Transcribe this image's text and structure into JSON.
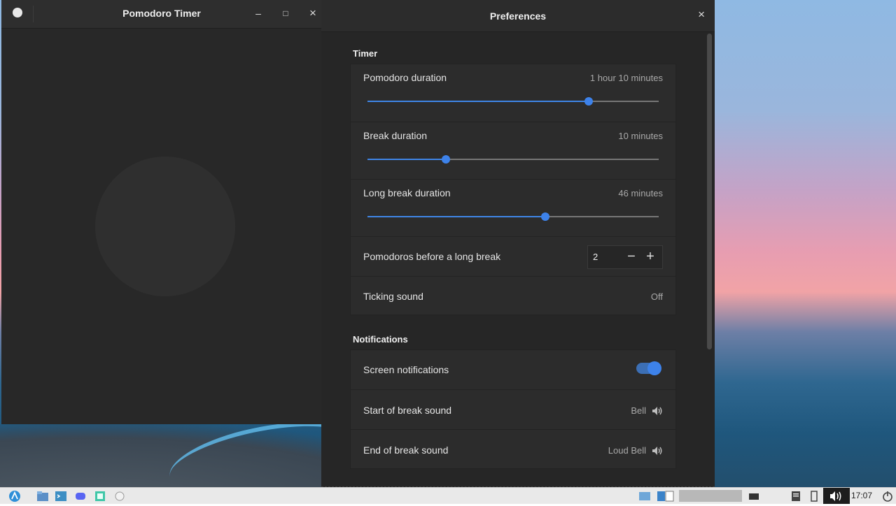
{
  "pomodoro_window": {
    "title": "Pomodoro Timer",
    "minimize_glyph": "–",
    "maximize_glyph": "□",
    "close_glyph": "×",
    "play_icon": "play-icon"
  },
  "preferences": {
    "title": "Preferences",
    "close_glyph": "×",
    "timer_section": "Timer",
    "pomodoro_duration": {
      "label": "Pomodoro duration",
      "value": "1 hour 10 minutes",
      "level": 0.76
    },
    "break_duration": {
      "label": "Break duration",
      "value": "10 minutes",
      "level": 0.27
    },
    "long_break_duration": {
      "label": "Long break duration",
      "value": "46 minutes",
      "level": 0.61
    },
    "pomodoros_before_long_break": {
      "label": "Pomodoros before a long break",
      "value": "2",
      "minus": "−",
      "plus": "+"
    },
    "ticking_sound": {
      "label": "Ticking sound",
      "value": "Off"
    },
    "notifications_section": "Notifications",
    "screen_notifications": {
      "label": "Screen notifications",
      "enabled": true
    },
    "start_of_break_sound": {
      "label": "Start of break sound",
      "value": "Bell"
    },
    "end_of_break_sound": {
      "label": "End of break sound",
      "value": "Loud Bell"
    }
  },
  "taskbar": {
    "clock": "17:07"
  },
  "colors": {
    "accent": "#3d82ea",
    "window_bg": "#282828",
    "card_bg": "#2c2c2c"
  }
}
